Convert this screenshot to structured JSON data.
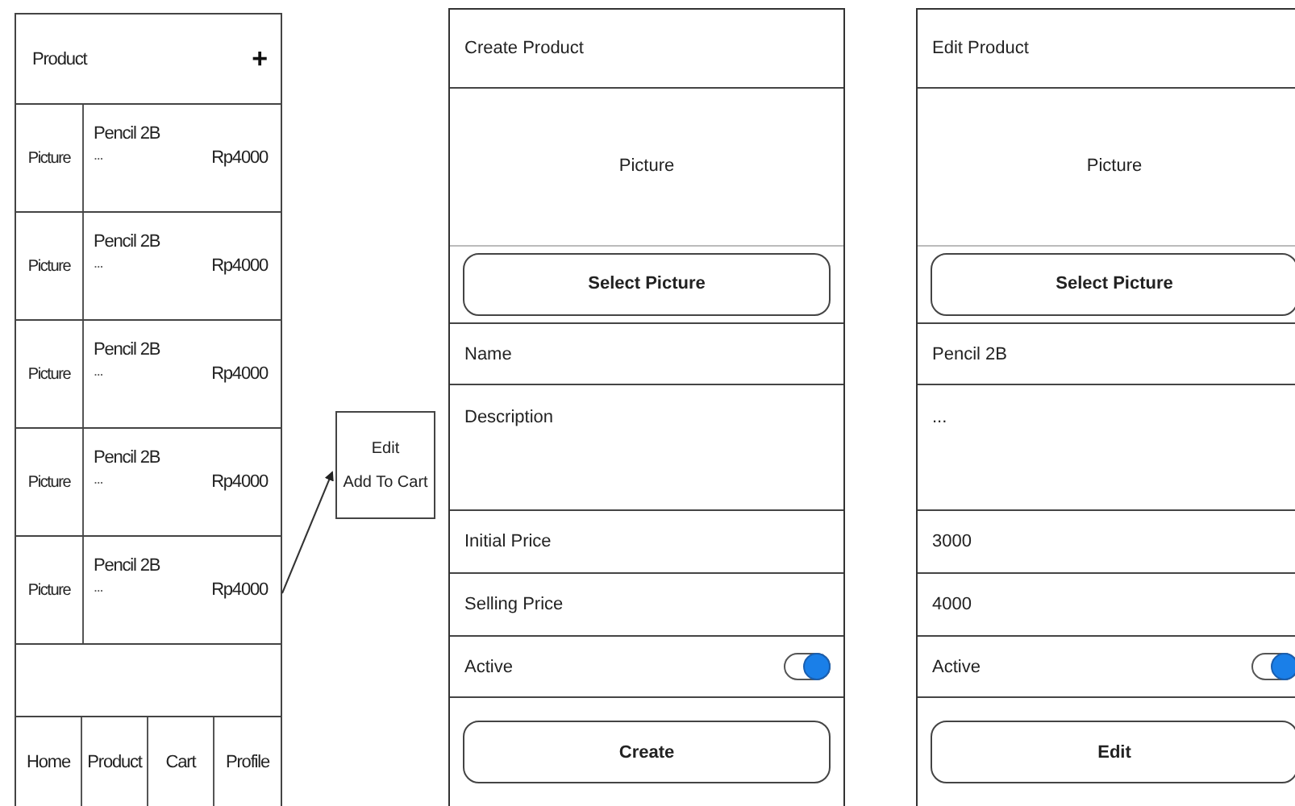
{
  "list_screen": {
    "title": "Product",
    "add_button": "+",
    "items": [
      {
        "picture": "Picture",
        "name": "Pencil 2B",
        "description": "...",
        "price": "Rp4000"
      },
      {
        "picture": "Picture",
        "name": "Pencil 2B",
        "description": "...",
        "price": "Rp4000"
      },
      {
        "picture": "Picture",
        "name": "Pencil 2B",
        "description": "...",
        "price": "Rp4000"
      },
      {
        "picture": "Picture",
        "name": "Pencil 2B",
        "description": "...",
        "price": "Rp4000"
      },
      {
        "picture": "Picture",
        "name": "Pencil 2B",
        "description": "...",
        "price": "Rp4000"
      }
    ],
    "nav": [
      "Home",
      "Product",
      "Cart",
      "Profile"
    ]
  },
  "popup_menu": [
    "Edit",
    "Add To Cart"
  ],
  "create_screen": {
    "title": "Create Product",
    "picture": "Picture",
    "select_button": "Select Picture",
    "fields": [
      {
        "kind": "input",
        "placeholder": "Name"
      },
      {
        "kind": "textarea",
        "placeholder": "Description"
      },
      {
        "kind": "input",
        "placeholder": "Initial Price"
      },
      {
        "kind": "input",
        "placeholder": "Selling Price"
      }
    ],
    "toggle": {
      "label": "Active",
      "on": true
    },
    "submit": "Create"
  },
  "edit_screen": {
    "title": "Edit Product",
    "picture": "Picture",
    "select_button": "Select Picture",
    "fields": [
      {
        "kind": "input",
        "value": "Pencil 2B"
      },
      {
        "kind": "textarea",
        "value": "..."
      },
      {
        "kind": "input",
        "value": "3000"
      },
      {
        "kind": "input",
        "value": "4000"
      }
    ],
    "toggle": {
      "label": "Active",
      "on": true
    },
    "submit": "Edit"
  }
}
